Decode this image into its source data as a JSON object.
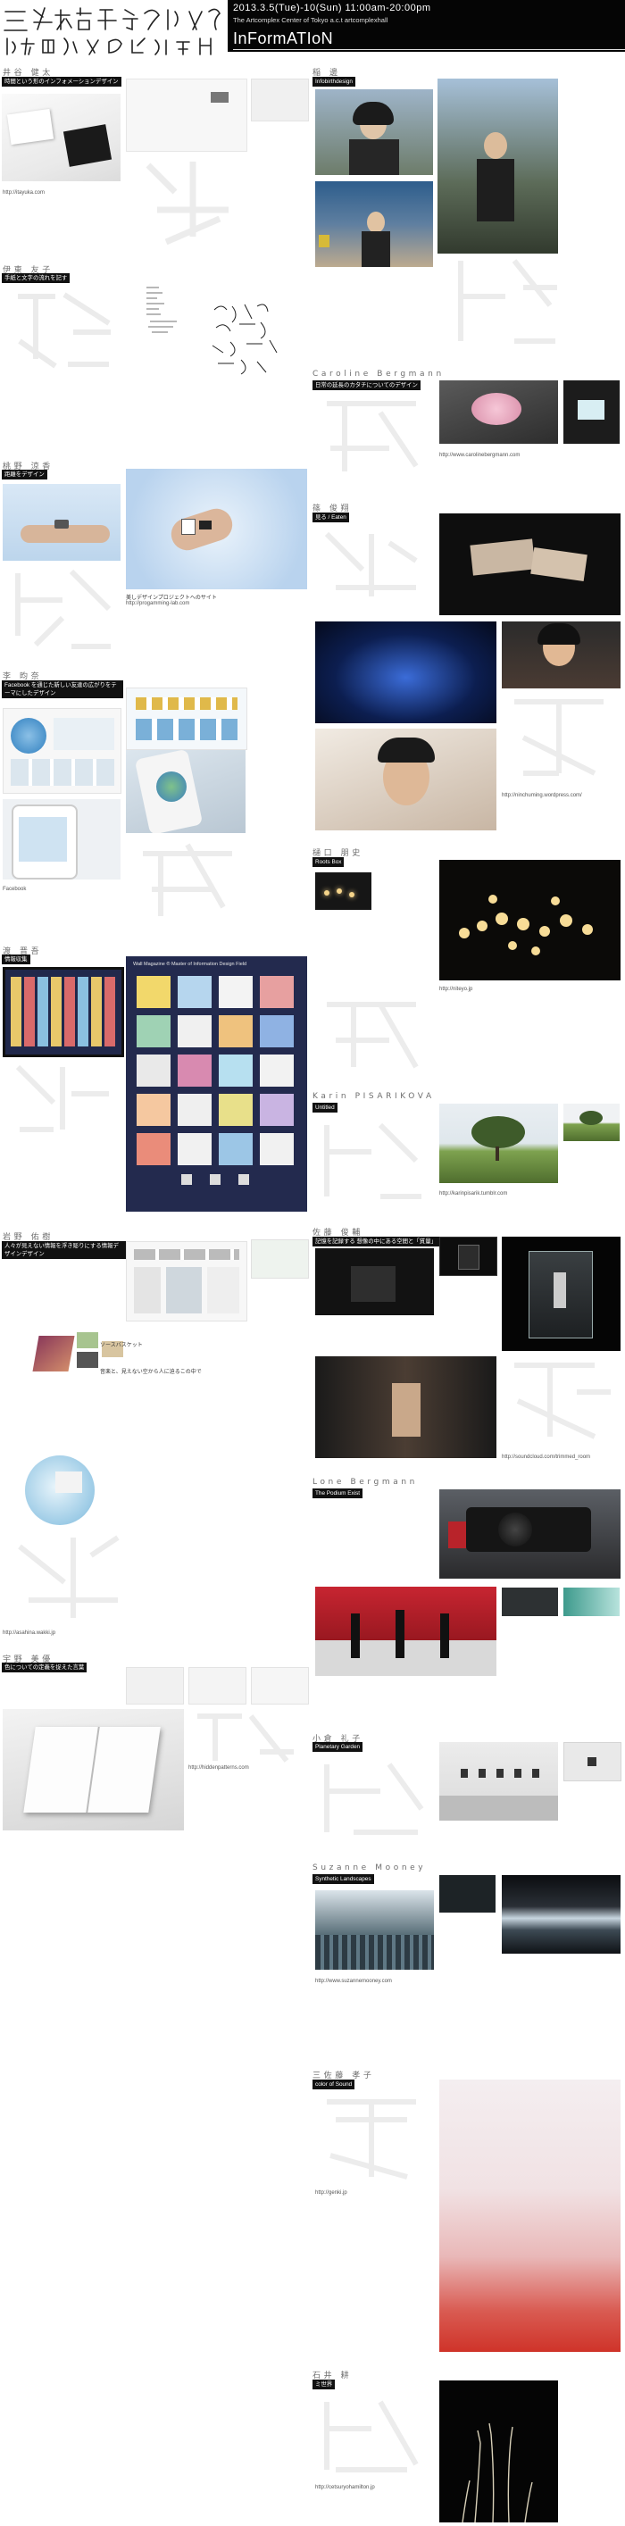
{
  "header": {
    "title_jp": "三分美術学校",
    "subtitle_jp": "ほかのデザインの方法 2013",
    "date": "2013.3.5(Tue)-10(Sun) 11:00am-20:00pm",
    "venue": "The Artcomplex Center of Tokyo a.c.t artcomplexhall",
    "info": "InFormATIoN"
  },
  "colors": {
    "header_bg": "#050505",
    "tag_bg": "#111111",
    "sky": "#cfe4f7",
    "red": "#d43a2e"
  },
  "artists": {
    "a1": {
      "name": "井谷 健太",
      "tag": "時間という形のインフォメーションデザイン",
      "url": "http://itayuka.com"
    },
    "a2": {
      "name": "稲 邊",
      "tag": "Infobirthdesign"
    },
    "a3": {
      "name": "伊東 友子",
      "tag": "手紙と文字の流れを記す"
    },
    "a4": {
      "name": "Caroline Bergmann",
      "tag": "日常の延長のカタチについてのデザイン",
      "url": "http://www.carolinebergmann.com"
    },
    "a5": {
      "name": "桃野 涼香",
      "tag": "距離をデザイン",
      "caption": "美しデザインプロジェクトへのサイト",
      "url": "http://progamming-lab.com"
    },
    "a6": {
      "name": "篠 俊翔",
      "tag": "見る / Eaten",
      "url": "http://ninchuming.wordpress.com/"
    },
    "a7": {
      "name": "李 昀奈",
      "tag": "Facebook を通じた新しい友達の広がりをテーマにしたデザイン",
      "url": "Facebook"
    },
    "a8": {
      "name": "樋口 朋史",
      "tag": "Roots Box",
      "url": "http://niteyo.jp"
    },
    "a9": {
      "name": "渡 晋吾",
      "tag": "情報収集",
      "wall_title": "Wall Magazine ® Master of Information Design Field"
    },
    "a10": {
      "name": "Karin PISARIKOVA",
      "tag": "Untitled",
      "url": "http://karinpisarik.tumblr.com"
    },
    "a11": {
      "name": "岩野 佑樹",
      "tag": "人々が見えない情報を浮き彫りにする情報デザインデザイン",
      "url": "http://asahina.wakki.jp",
      "note1": "ソースバスケット",
      "note2": "音楽と、見えない空から人に迫るこの中で"
    },
    "a12": {
      "name": "佐藤 俊輔",
      "tag": "記憶を記録する 想像の中にある空間と「質量」",
      "url": "http://soundcloud.com/trimmed_room"
    },
    "a13": {
      "name": "Lone Bergmann",
      "tag": "The Podium Exist"
    },
    "a14": {
      "name": "宇野 美優",
      "tag": "色についての定義を捉えた言葉",
      "url": "http://hiddenpatterns.com"
    },
    "a15": {
      "name": "小倉 礼子",
      "tag": "Planetary Garden"
    },
    "a16": {
      "name": "Suzanne Mooney",
      "tag": "Synthetic Landscapes",
      "url": "http://www.suzannemooney.com"
    },
    "a17": {
      "name": "三佐藤 孝子",
      "tag": "color of Sound",
      "url": "http://genki.jp"
    },
    "a18": {
      "name": "石井 耕",
      "tag": "ミ世界",
      "url": "http://cetsuryohamilton.jp"
    }
  }
}
